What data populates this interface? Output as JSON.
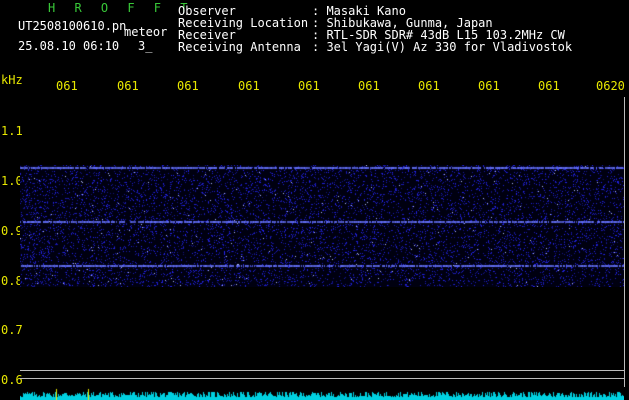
{
  "header": {
    "title": "H R O F F T",
    "filename": "UT2508100610.pn",
    "mode": "meteor",
    "datetime": "25.08.10 06:10",
    "count": "3_"
  },
  "info": {
    "labels": [
      "Observer",
      "Receiving Location",
      "Receiver",
      "Receiving Antenna"
    ],
    "values": [
      ": Masaki Kano",
      ": Shibukawa, Gunma, Japan",
      ": RTL-SDR SDR# 43dB L15 103.2MHz CW",
      ": 3el Yagi(V) Az 330 for Vladivostok"
    ]
  },
  "axis": {
    "unit": "kHz",
    "time_ticks": [
      "061",
      "061",
      "061",
      "061",
      "061",
      "061",
      "061",
      "061",
      "061",
      "0620"
    ],
    "freq_ticks": [
      "1.1",
      "1.0",
      "0.9",
      "0.8",
      "0.7",
      "0.6"
    ]
  },
  "colors": {
    "background": "#000000",
    "text": "#ffffff",
    "title": "#38c838",
    "axis": "#e8e800",
    "signal": "#2a2aff",
    "baseline": "#00d8e8"
  }
}
